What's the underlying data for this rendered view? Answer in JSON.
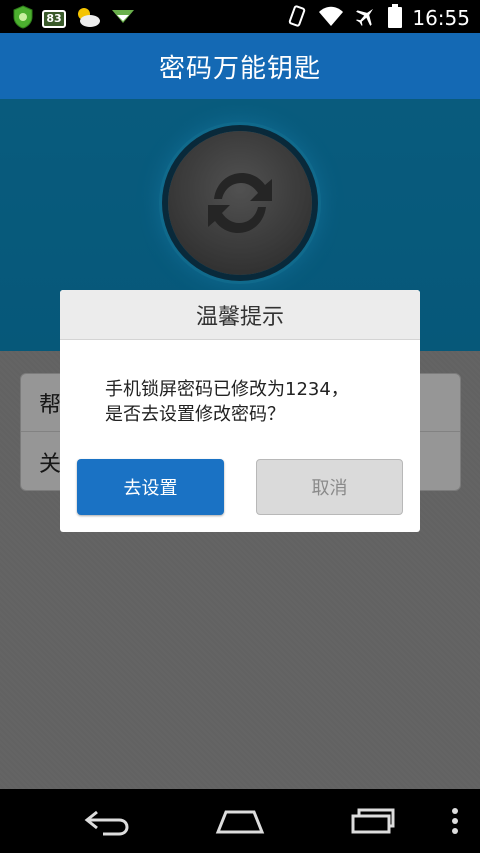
{
  "status_bar": {
    "battery_badge": "83",
    "time": "16:55"
  },
  "app": {
    "title": "密码万能钥匙"
  },
  "menu": {
    "items": [
      {
        "label": "帮"
      },
      {
        "label": "关"
      }
    ]
  },
  "dialog": {
    "title": "温馨提示",
    "message_line1": "手机锁屏密码已修改为1234，",
    "message_line2": "是否去设置修改密码？",
    "confirm_label": "去设置",
    "cancel_label": "取消"
  },
  "colors": {
    "title_bar": "#1469b4",
    "hero": "#0e8dc1",
    "confirm_button": "#1a72c4"
  },
  "icons": [
    "shield-app-icon",
    "badge-83-icon",
    "weather-icon",
    "download-icon",
    "vibrate-icon",
    "wifi-icon",
    "airplane-icon",
    "battery-icon",
    "refresh-icon",
    "back-icon",
    "home-icon",
    "recents-icon",
    "overflow-menu-icon"
  ]
}
